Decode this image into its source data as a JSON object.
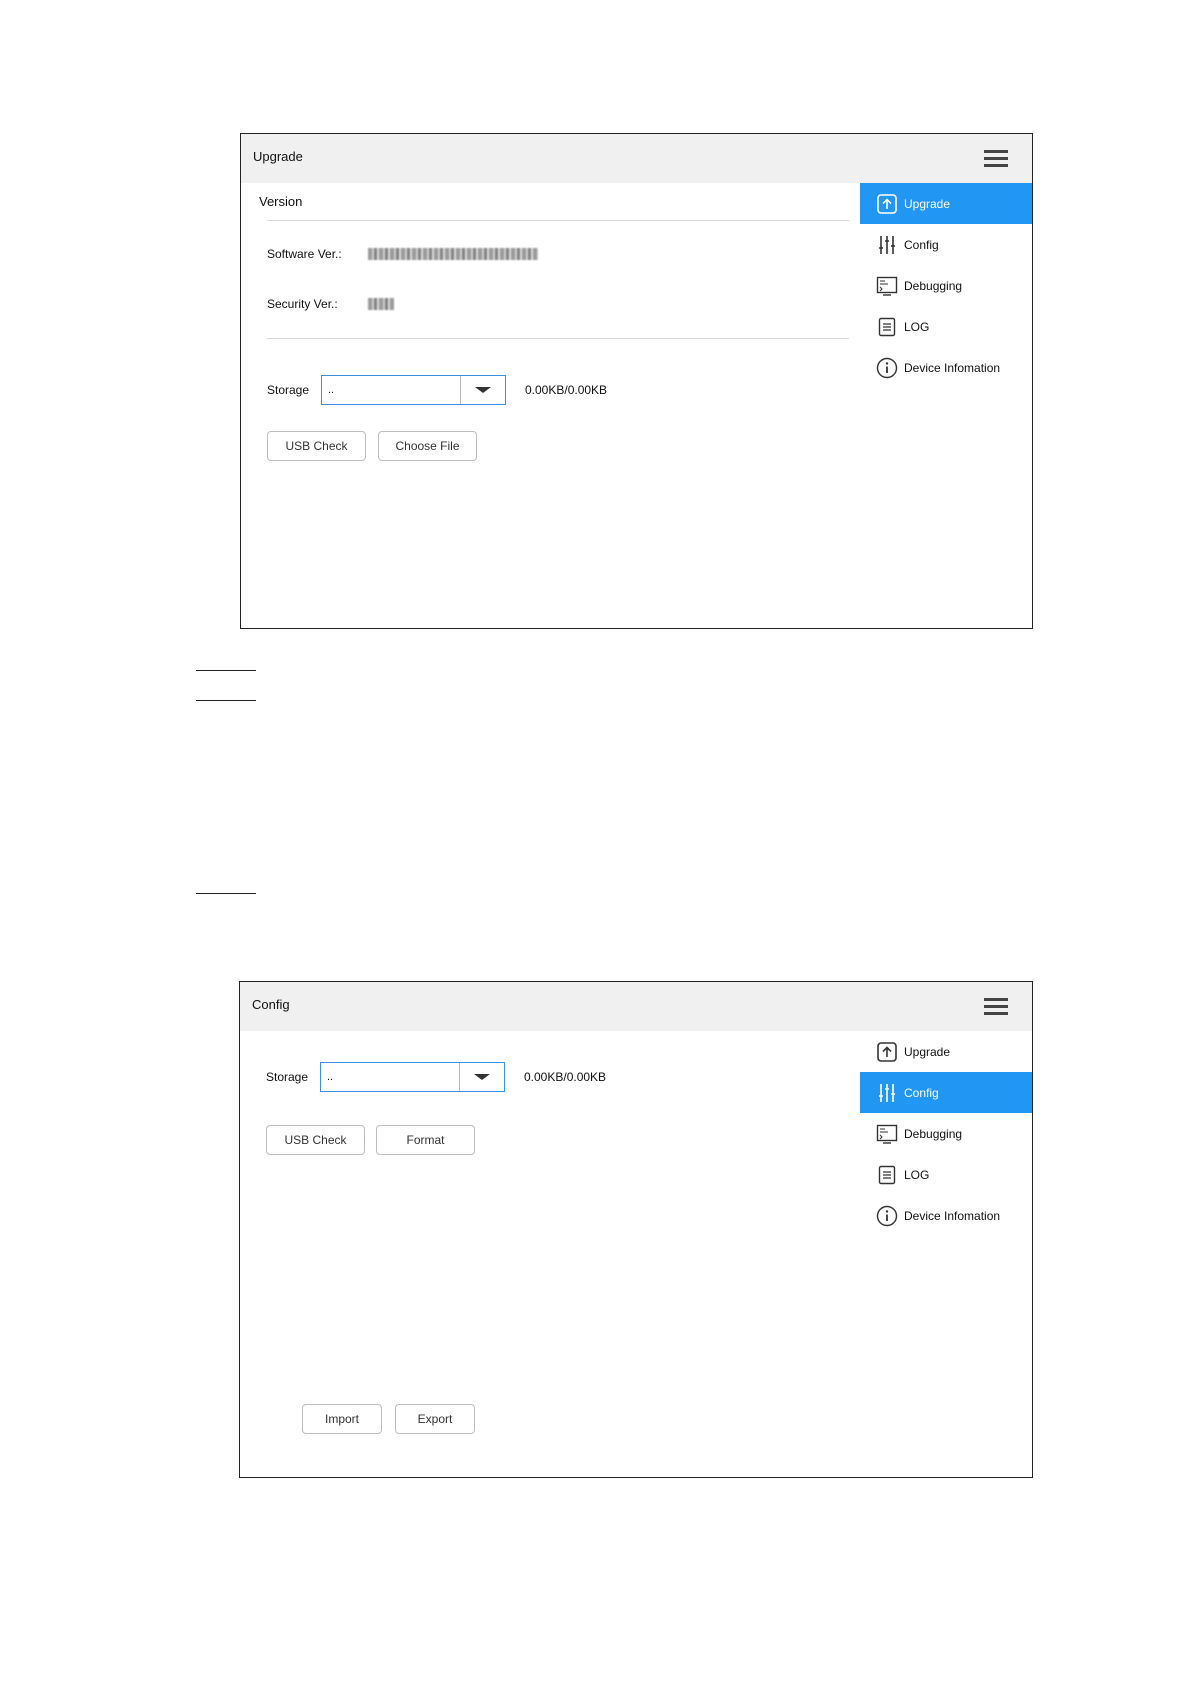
{
  "upgrade_panel": {
    "title": "Upgrade",
    "version_section": "Version",
    "software_label": "Software Ver.:",
    "security_label": "Security Ver.:",
    "storage_label": "Storage",
    "storage_value": "..",
    "storage_capacity": "0.00KB/0.00KB",
    "usb_check_label": "USB Check",
    "choose_file_label": "Choose File",
    "sidebar": [
      {
        "label": "Upgrade",
        "icon": "upgrade-icon",
        "active": true
      },
      {
        "label": "Config",
        "icon": "config-icon",
        "active": false
      },
      {
        "label": "Debugging",
        "icon": "debugging-icon",
        "active": false
      },
      {
        "label": "LOG",
        "icon": "log-icon",
        "active": false
      },
      {
        "label": "Device Infomation",
        "icon": "info-icon",
        "active": false
      }
    ]
  },
  "config_panel": {
    "title": "Config",
    "storage_label": "Storage",
    "storage_value": "..",
    "storage_capacity": "0.00KB/0.00KB",
    "usb_check_label": "USB Check",
    "format_label": "Format",
    "import_label": "Import",
    "export_label": "Export",
    "sidebar": [
      {
        "label": "Upgrade",
        "icon": "upgrade-icon",
        "active": false
      },
      {
        "label": "Config",
        "icon": "config-icon",
        "active": true
      },
      {
        "label": "Debugging",
        "icon": "debugging-icon",
        "active": false
      },
      {
        "label": "LOG",
        "icon": "log-icon",
        "active": false
      },
      {
        "label": "Device Infomation",
        "icon": "info-icon",
        "active": false
      }
    ]
  },
  "colors": {
    "accent": "#2196f3",
    "header_bg": "#f0f0f0",
    "border": "#222222"
  }
}
